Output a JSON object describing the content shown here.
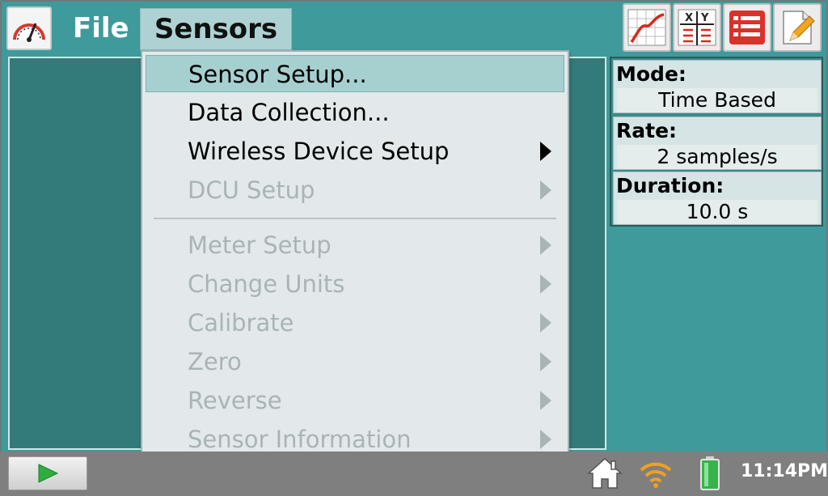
{
  "menubar": {
    "file_label": "File",
    "sensors_label": "Sensors"
  },
  "toolbar": {
    "icons": [
      "meter-icon",
      "graph-icon",
      "table-icon",
      "list-icon",
      "notes-icon"
    ]
  },
  "sensors_menu": {
    "items": [
      {
        "label": "Sensor Setup...",
        "enabled": true,
        "submenu": false,
        "highlighted": true
      },
      {
        "label": "Data Collection...",
        "enabled": true,
        "submenu": false
      },
      {
        "label": "Wireless Device Setup",
        "enabled": true,
        "submenu": true
      },
      {
        "label": "DCU Setup",
        "enabled": false,
        "submenu": true
      },
      {
        "label": "Meter Setup",
        "enabled": false,
        "submenu": true
      },
      {
        "label": "Change Units",
        "enabled": false,
        "submenu": true
      },
      {
        "label": "Calibrate",
        "enabled": false,
        "submenu": true
      },
      {
        "label": "Zero",
        "enabled": false,
        "submenu": true
      },
      {
        "label": "Reverse",
        "enabled": false,
        "submenu": true
      },
      {
        "label": "Sensor Information",
        "enabled": false,
        "submenu": true
      }
    ]
  },
  "info_panel": {
    "mode_label": "Mode:",
    "mode_value": "Time Based",
    "rate_label": "Rate:",
    "rate_value": "2 samples/s",
    "duration_label": "Duration:",
    "duration_value": "10.0 s"
  },
  "statusbar": {
    "time": "11:14PM",
    "icons": [
      "home-icon",
      "wifi-icon",
      "battery-icon"
    ]
  },
  "colors": {
    "background": "#3f9a9c",
    "graph_area": "#337a7a",
    "menu_bg": "#e3e9ea",
    "menu_highlight": "#a6cfd0",
    "disabled_text": "#a9b4b5",
    "play_green": "#2fae3f",
    "battery_green": "#37b34a"
  }
}
